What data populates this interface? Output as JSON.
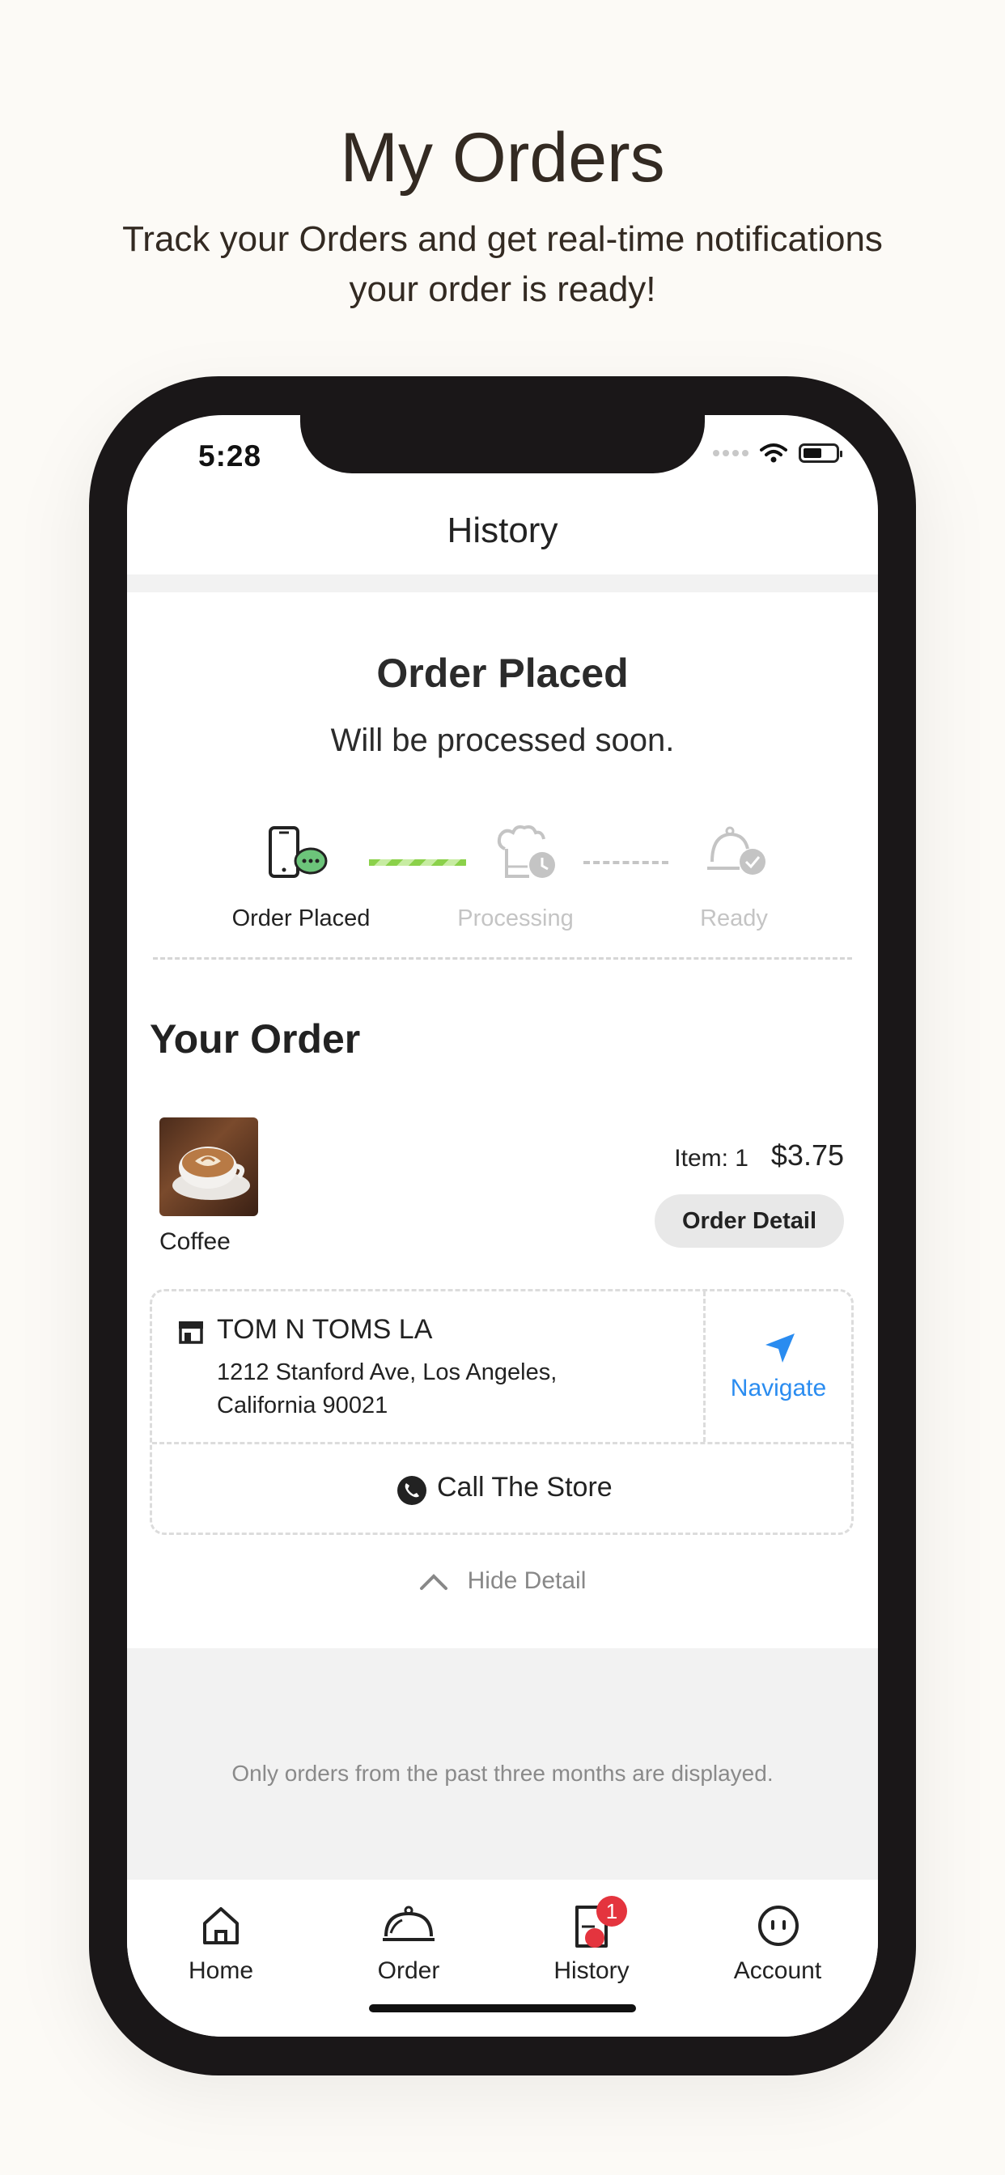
{
  "promo": {
    "title": "My Orders",
    "subtitle_line1": "Track your Orders and get real-time notifications",
    "subtitle_line2": "your order is ready!"
  },
  "status_bar": {
    "time": "5:28"
  },
  "header": {
    "title": "History"
  },
  "order_status": {
    "title": "Order Placed",
    "subtitle": "Will be processed soon.",
    "steps": [
      {
        "label": "Order Placed",
        "state": "done",
        "icon": "phone-chat-icon"
      },
      {
        "label": "Processing",
        "state": "pending",
        "icon": "chef-hat-clock-icon"
      },
      {
        "label": "Ready",
        "state": "pending",
        "icon": "serving-bell-check-icon"
      }
    ],
    "colors": {
      "done_text": "#222222",
      "pending_text": "#c4c4c4",
      "progress": "#8bd14a"
    }
  },
  "your_order": {
    "heading": "Your Order",
    "item": {
      "name": "Coffee",
      "count_label": "Item: 1",
      "price": "$3.75"
    },
    "order_detail_button": "Order Detail"
  },
  "store": {
    "name": "TOM N TOMS LA",
    "address_line1": "1212 Stanford Ave, Los Angeles,",
    "address_line2": "California 90021",
    "navigate_label": "Navigate",
    "call_label": "Call The Store",
    "accent": "#2a8cf0"
  },
  "hide_detail": "Hide Detail",
  "footer_note": "Only orders from the past three months are displayed.",
  "tabbar": {
    "items": [
      {
        "label": "Home",
        "icon": "house-icon"
      },
      {
        "label": "Order",
        "icon": "cloche-icon"
      },
      {
        "label": "History",
        "icon": "document-icon",
        "badge": "1"
      },
      {
        "label": "Account",
        "icon": "face-icon"
      }
    ],
    "badge_color": "#e4343e"
  }
}
